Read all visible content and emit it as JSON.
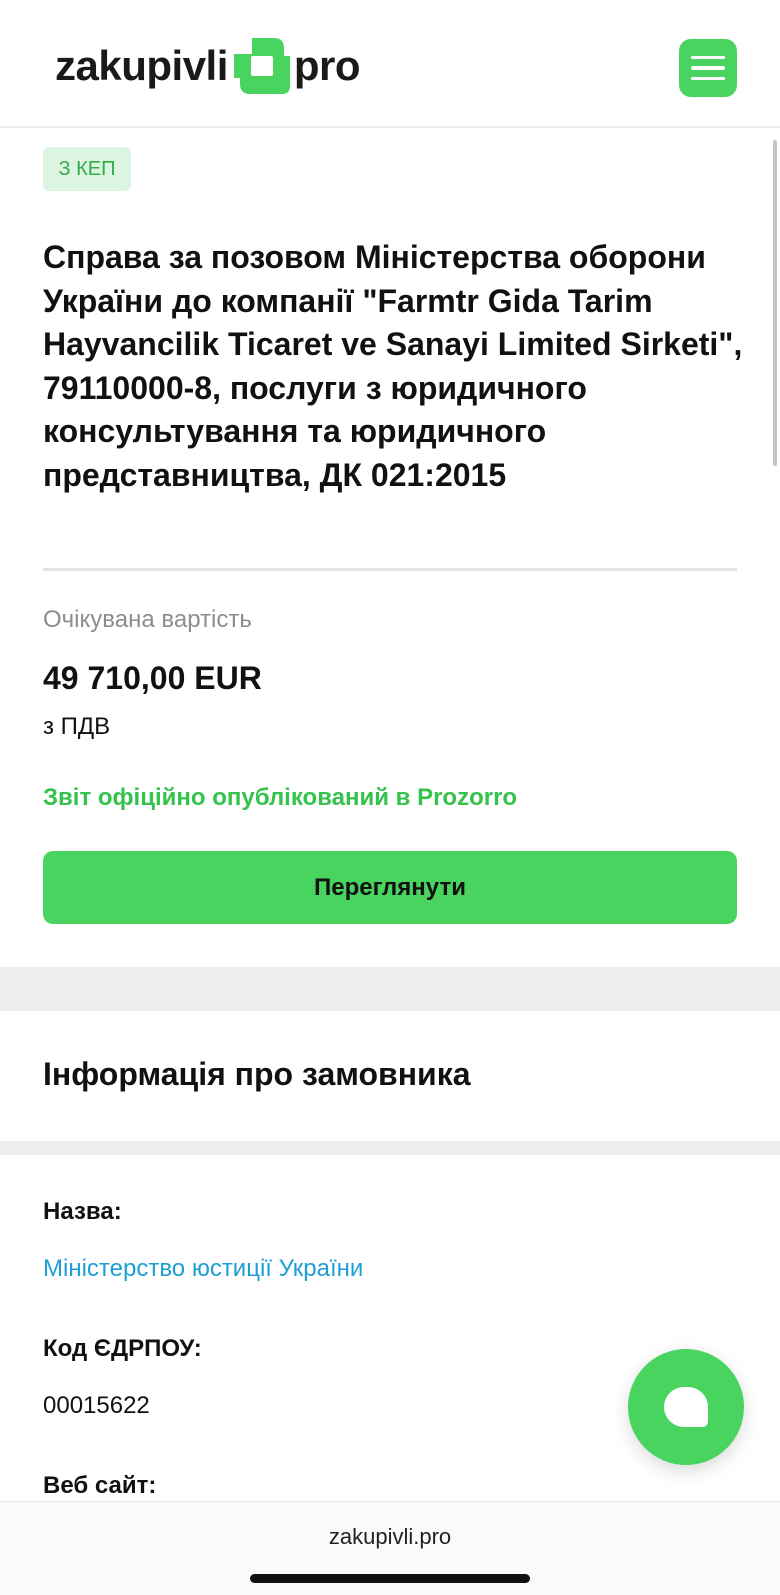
{
  "header": {
    "logo_left": "zakupivli",
    "logo_right": "pro",
    "menu_icon": "hamburger-menu-icon"
  },
  "tender": {
    "badge": "З КЕП",
    "title": "Справа за позовом Міністерства оборони України до компанії \"Farmtr Gida Tarim Hayvancilik Ticaret ve Sanayi Limited Sirketi\", 79110000-8, послуги з юридичного консультування та юридичного представництва, ДК 021:2015",
    "expected_cost_label": "Очікувана вартість",
    "expected_cost_value": "49 710,00 EUR",
    "vat_note": "з ПДВ",
    "published_note": "Звіт офіційно опублікований в Prozorro",
    "view_button": "Переглянути"
  },
  "customer": {
    "section_title": "Інформація про замовника",
    "name_label": "Назва:",
    "name_value": "Міністерство юстиції України",
    "code_label": "Код ЄДРПОУ:",
    "code_value": "00015622",
    "website_label": "Веб сайт:"
  },
  "chat": {
    "icon": "chat-bubble-icon"
  },
  "browser": {
    "url": "zakupivli.pro"
  },
  "colors": {
    "brand_green": "#48d45f",
    "published_green": "#35c24d",
    "link_blue": "#1d9fd4",
    "badge_bg": "#dcf5e2"
  }
}
